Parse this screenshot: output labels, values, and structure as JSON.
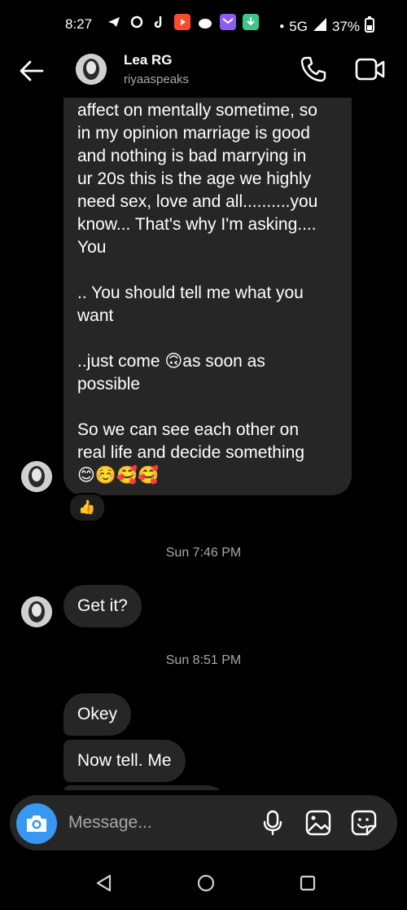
{
  "status_bar": {
    "time": "8:27",
    "network": "5G",
    "battery": "37%",
    "notification_icons": [
      "telegram-icon",
      "g-icon",
      "tiktok-icon",
      "youtube-icon",
      "reddit-icon",
      "mail-icon",
      "download-icon"
    ]
  },
  "header": {
    "name": "Lea RG",
    "username": "riyaaspeaks"
  },
  "messages": {
    "long_text": "affect on mentally sometime, so\nin my opinion marriage is good\nand nothing is bad marrying in\nur 20s this is the age we highly\nneed sex, love and all..........you\nknow... That's why I'm asking....\nYou\n\n.. You should tell me what you\nwant\n\n..just come 🙃as soon as\npossible\n\nSo we can see each other on\nreal life and decide something\n😊☺️🥰🥰",
    "reaction": "👍",
    "timestamp_1": "Sun 7:46 PM",
    "msg_get_it": "Get it?",
    "timestamp_2": "Sun 8:51 PM",
    "msg_okey": "Okey",
    "msg_now_tell": "Now tell. Me"
  },
  "composer": {
    "placeholder": "Message..."
  },
  "colors": {
    "background": "#000000",
    "bubble": "#262626",
    "accent": "#3897f0",
    "muted": "#a8a8a8"
  }
}
